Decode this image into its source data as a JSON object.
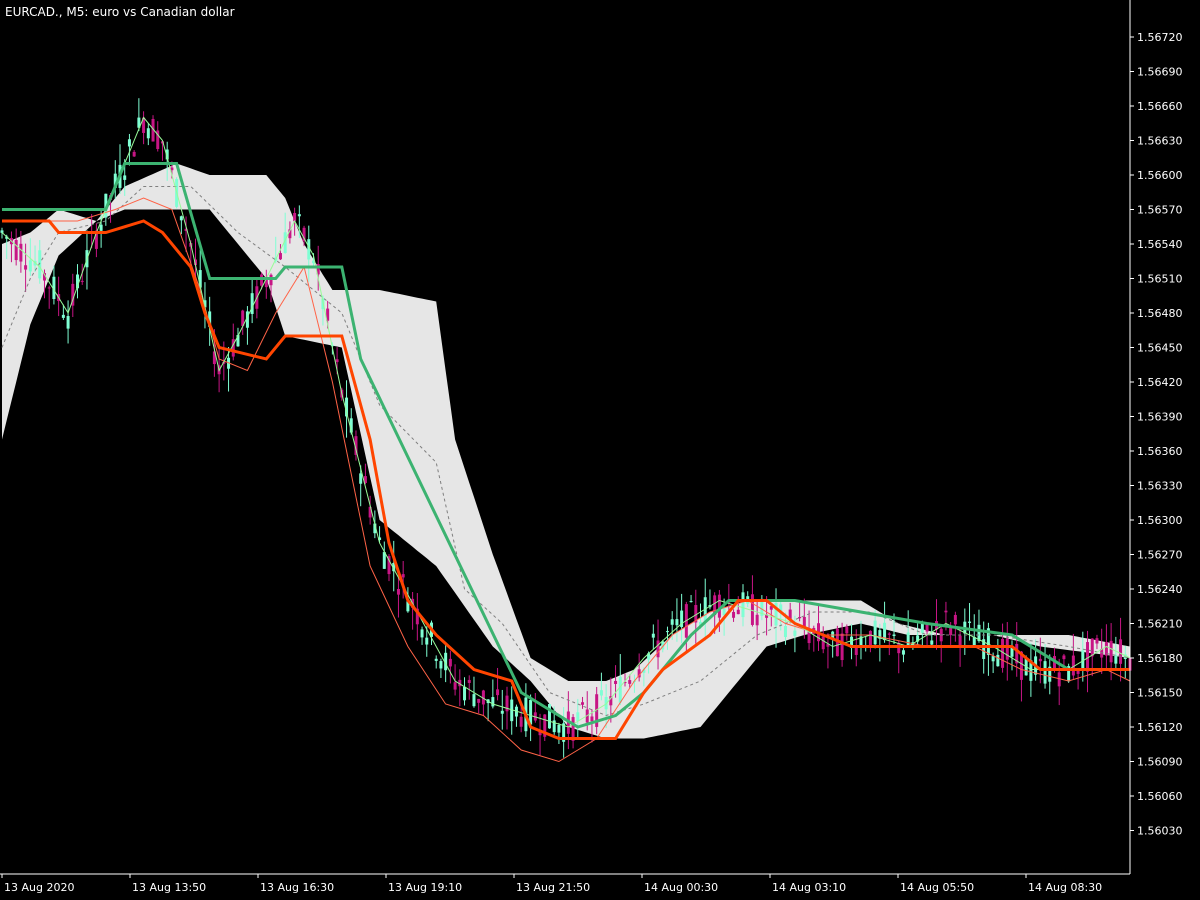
{
  "colors": {
    "background": "#000000",
    "axis": "#ffffff",
    "cloud": "#e6e6e6",
    "kijun": "#ff4500",
    "tenkan": "#3cb371",
    "candle_up": "#7fffd4",
    "candle_down": "#c71585",
    "ma_fast": "#98fb98",
    "ma_slow": "#ff6347",
    "mid_dash": "#7f7f7f"
  },
  "chart_data": {
    "type": "candlestick",
    "title": "EURCAD., M5:  euro vs Canadian dollar",
    "y_ticks": [
      "1.56720",
      "1.56690",
      "1.56660",
      "1.56630",
      "1.56600",
      "1.56570",
      "1.56540",
      "1.56510",
      "1.56480",
      "1.56450",
      "1.56420",
      "1.56390",
      "1.56360",
      "1.56330",
      "1.56300",
      "1.56270",
      "1.56240",
      "1.56210",
      "1.56180",
      "1.56150",
      "1.56120",
      "1.56090",
      "1.56060",
      "1.56030"
    ],
    "x_ticks": [
      "13 Aug 2020",
      "13 Aug 13:50",
      "13 Aug 16:30",
      "13 Aug 19:10",
      "13 Aug 21:50",
      "14 Aug 00:30",
      "14 Aug 03:10",
      "14 Aug 05:50",
      "14 Aug 08:30"
    ],
    "ylim": [
      1.5601,
      1.5675
    ],
    "x_index_range": [
      0,
      239
    ],
    "series": [
      {
        "name": "",
        "role": "kijun",
        "points": [
          [
            0,
            1.5656
          ],
          [
            10,
            1.5656
          ],
          [
            12,
            1.5655
          ],
          [
            22,
            1.5655
          ],
          [
            30,
            1.5656
          ],
          [
            34,
            1.5655
          ],
          [
            40,
            1.5652
          ],
          [
            43,
            1.5648
          ],
          [
            46,
            1.5645
          ],
          [
            56,
            1.5644
          ],
          [
            60,
            1.5646
          ],
          [
            72,
            1.5646
          ],
          [
            78,
            1.5637
          ],
          [
            82,
            1.5628
          ],
          [
            86,
            1.5623
          ],
          [
            92,
            1.562
          ],
          [
            100,
            1.5617
          ],
          [
            108,
            1.5616
          ],
          [
            112,
            1.5612
          ],
          [
            118,
            1.5611
          ],
          [
            130,
            1.5611
          ],
          [
            136,
            1.5615
          ],
          [
            140,
            1.5617
          ],
          [
            150,
            1.562
          ],
          [
            156,
            1.5623
          ],
          [
            162,
            1.5623
          ],
          [
            168,
            1.5621
          ],
          [
            174,
            1.562
          ],
          [
            180,
            1.5619
          ],
          [
            214,
            1.5619
          ],
          [
            220,
            1.5617
          ],
          [
            226,
            1.5617
          ],
          [
            239,
            1.5617
          ]
        ]
      },
      {
        "name": "",
        "role": "tenkan",
        "points": [
          [
            0,
            1.5657
          ],
          [
            6,
            1.5657
          ],
          [
            12,
            1.5657
          ],
          [
            22,
            1.5657
          ],
          [
            26,
            1.5661
          ],
          [
            37,
            1.5661
          ],
          [
            44,
            1.5651
          ],
          [
            58,
            1.5651
          ],
          [
            60,
            1.5652
          ],
          [
            72,
            1.5652
          ],
          [
            76,
            1.5644
          ],
          [
            110,
            1.5615
          ],
          [
            122,
            1.5612
          ],
          [
            130,
            1.5613
          ],
          [
            136,
            1.5615
          ],
          [
            146,
            1.562
          ],
          [
            154,
            1.5623
          ],
          [
            158,
            1.5623
          ],
          [
            168,
            1.5623
          ],
          [
            196,
            1.5621
          ],
          [
            214,
            1.562
          ],
          [
            226,
            1.5617
          ],
          [
            239,
            1.5617
          ]
        ]
      },
      {
        "name": "",
        "role": "cloud_upper",
        "points": [
          [
            0,
            1.5654
          ],
          [
            6,
            1.5655
          ],
          [
            12,
            1.5657
          ],
          [
            20,
            1.5656
          ],
          [
            26,
            1.5659
          ],
          [
            37,
            1.5661
          ],
          [
            44,
            1.566
          ],
          [
            56,
            1.566
          ],
          [
            60,
            1.5658
          ],
          [
            64,
            1.5654
          ],
          [
            70,
            1.565
          ],
          [
            80,
            1.565
          ],
          [
            92,
            1.5649
          ],
          [
            96,
            1.5637
          ],
          [
            104,
            1.5627
          ],
          [
            112,
            1.5618
          ],
          [
            120,
            1.5616
          ],
          [
            128,
            1.5616
          ],
          [
            134,
            1.5617
          ],
          [
            142,
            1.562
          ],
          [
            150,
            1.5622
          ],
          [
            158,
            1.5623
          ],
          [
            168,
            1.5623
          ],
          [
            182,
            1.5623
          ],
          [
            190,
            1.5621
          ],
          [
            200,
            1.562
          ],
          [
            214,
            1.562
          ],
          [
            226,
            1.562
          ],
          [
            239,
            1.5619
          ]
        ]
      },
      {
        "name": "",
        "role": "cloud_lower",
        "points": [
          [
            0,
            1.5637
          ],
          [
            6,
            1.5647
          ],
          [
            12,
            1.5653
          ],
          [
            20,
            1.5656
          ],
          [
            26,
            1.5657
          ],
          [
            37,
            1.5657
          ],
          [
            44,
            1.5657
          ],
          [
            56,
            1.5651
          ],
          [
            60,
            1.5646
          ],
          [
            72,
            1.5645
          ],
          [
            80,
            1.563
          ],
          [
            92,
            1.5626
          ],
          [
            104,
            1.5619
          ],
          [
            112,
            1.5616
          ],
          [
            120,
            1.5612
          ],
          [
            128,
            1.5611
          ],
          [
            136,
            1.5611
          ],
          [
            148,
            1.5612
          ],
          [
            156,
            1.5616
          ],
          [
            162,
            1.5619
          ],
          [
            170,
            1.562
          ],
          [
            182,
            1.5621
          ],
          [
            192,
            1.562
          ],
          [
            200,
            1.562
          ],
          [
            210,
            1.562
          ],
          [
            220,
            1.5619
          ],
          [
            239,
            1.5618
          ]
        ]
      },
      {
        "name": "",
        "role": "ma_fast",
        "points": [
          [
            0,
            1.5655
          ],
          [
            8,
            1.5652
          ],
          [
            14,
            1.5648
          ],
          [
            20,
            1.5655
          ],
          [
            26,
            1.5661
          ],
          [
            30,
            1.5665
          ],
          [
            34,
            1.5663
          ],
          [
            40,
            1.5654
          ],
          [
            46,
            1.5643
          ],
          [
            50,
            1.5646
          ],
          [
            56,
            1.5651
          ],
          [
            62,
            1.5656
          ],
          [
            66,
            1.5653
          ],
          [
            72,
            1.5641
          ],
          [
            80,
            1.5628
          ],
          [
            88,
            1.5622
          ],
          [
            96,
            1.5616
          ],
          [
            104,
            1.5614
          ],
          [
            112,
            1.5613
          ],
          [
            120,
            1.5612
          ],
          [
            128,
            1.5614
          ],
          [
            136,
            1.5618
          ],
          [
            144,
            1.5621
          ],
          [
            152,
            1.5623
          ],
          [
            160,
            1.5622
          ],
          [
            168,
            1.5621
          ],
          [
            176,
            1.5619
          ],
          [
            184,
            1.562
          ],
          [
            192,
            1.5619
          ],
          [
            200,
            1.5621
          ],
          [
            210,
            1.5619
          ],
          [
            218,
            1.5617
          ],
          [
            226,
            1.5617
          ],
          [
            234,
            1.5619
          ],
          [
            239,
            1.5618
          ]
        ]
      },
      {
        "name": "",
        "role": "ma_slow",
        "points": [
          [
            0,
            1.5656
          ],
          [
            8,
            1.5656
          ],
          [
            16,
            1.5656
          ],
          [
            24,
            1.5657
          ],
          [
            30,
            1.5658
          ],
          [
            36,
            1.5657
          ],
          [
            42,
            1.565
          ],
          [
            46,
            1.5644
          ],
          [
            52,
            1.5643
          ],
          [
            58,
            1.5648
          ],
          [
            64,
            1.5652
          ],
          [
            70,
            1.5642
          ],
          [
            78,
            1.5626
          ],
          [
            86,
            1.5619
          ],
          [
            94,
            1.5614
          ],
          [
            102,
            1.5613
          ],
          [
            110,
            1.561
          ],
          [
            118,
            1.5609
          ],
          [
            126,
            1.5611
          ],
          [
            134,
            1.5616
          ],
          [
            142,
            1.562
          ],
          [
            150,
            1.5622
          ],
          [
            158,
            1.5623
          ],
          [
            166,
            1.5621
          ],
          [
            174,
            1.562
          ],
          [
            184,
            1.562
          ],
          [
            196,
            1.5619
          ],
          [
            206,
            1.5619
          ],
          [
            216,
            1.5617
          ],
          [
            226,
            1.5616
          ],
          [
            234,
            1.5617
          ],
          [
            239,
            1.5616
          ]
        ]
      },
      {
        "name": "",
        "role": "mid_dash",
        "points": [
          [
            0,
            1.5645
          ],
          [
            6,
            1.5651
          ],
          [
            12,
            1.5655
          ],
          [
            22,
            1.5656
          ],
          [
            30,
            1.5659
          ],
          [
            40,
            1.5659
          ],
          [
            50,
            1.5655
          ],
          [
            60,
            1.5652
          ],
          [
            72,
            1.5648
          ],
          [
            80,
            1.564
          ],
          [
            92,
            1.5635
          ],
          [
            98,
            1.5624
          ],
          [
            106,
            1.5621
          ],
          [
            116,
            1.5615
          ],
          [
            128,
            1.5613
          ],
          [
            136,
            1.5614
          ],
          [
            148,
            1.5616
          ],
          [
            160,
            1.562
          ],
          [
            172,
            1.5622
          ],
          [
            184,
            1.5622
          ],
          [
            196,
            1.562
          ],
          [
            210,
            1.562
          ],
          [
            226,
            1.5619
          ],
          [
            239,
            1.5618
          ]
        ]
      }
    ]
  }
}
